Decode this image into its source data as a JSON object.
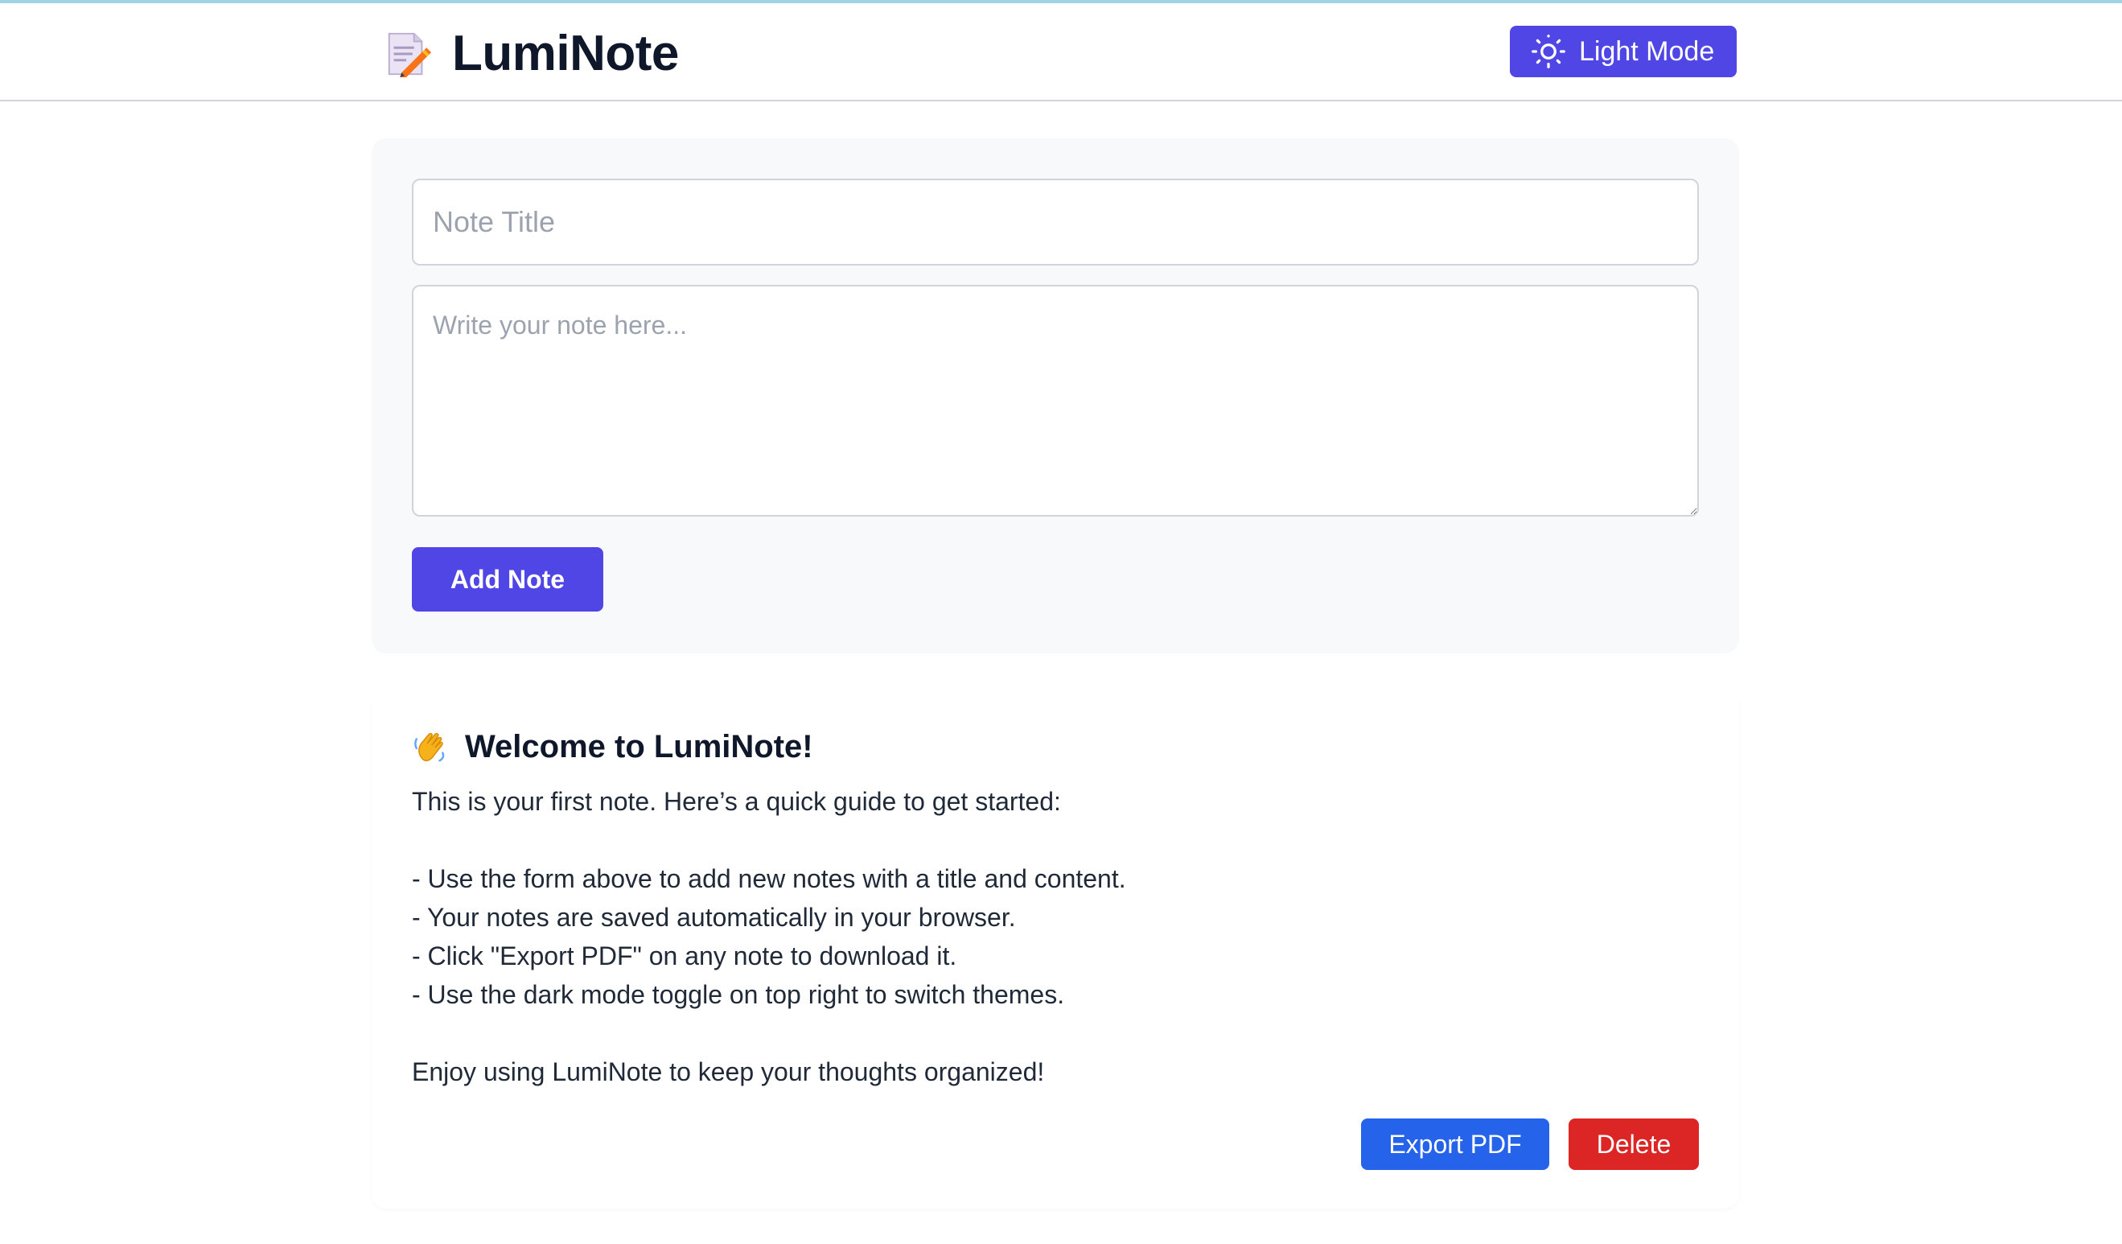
{
  "header": {
    "logo_icon": "memo-pencil-icon",
    "app_title": "LumiNote",
    "theme_toggle": {
      "icon": "sun-icon",
      "label": "Light Mode"
    }
  },
  "note_form": {
    "title_placeholder": "Note Title",
    "title_value": "",
    "content_placeholder": "Write your note here...",
    "content_value": "",
    "add_button_label": "Add Note"
  },
  "notes": [
    {
      "icon": "waving-hand-icon",
      "title": "Welcome to LumiNote!",
      "body": "This is your first note. Here’s a quick guide to get started:\n\n- Use the form above to add new notes with a title and content.\n- Your notes are saved automatically in your browser.\n- Click \"Export PDF\" on any note to download it.\n- Use the dark mode toggle on top right to switch themes.\n\nEnjoy using LumiNote to keep your thoughts organized!",
      "export_label": "Export PDF",
      "delete_label": "Delete"
    }
  ],
  "colors": {
    "accent": "#4f46e5",
    "export": "#2563eb",
    "delete": "#dc2626",
    "top_bar": "#9fd3e6"
  }
}
